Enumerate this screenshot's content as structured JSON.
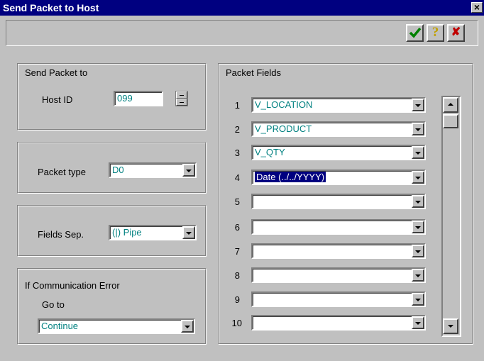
{
  "window": {
    "title": "Send Packet to Host",
    "close_glyph": "×"
  },
  "toolbar": {
    "ok_icon": "green-check-icon",
    "help_glyph": "?",
    "cancel_glyph": "✘",
    "colors": {
      "ok": "#008000",
      "help": "#c0a000",
      "cancel": "#c00000"
    }
  },
  "send_packet": {
    "group_label": "Send Packet to",
    "host_label": "Host ID",
    "host_value": "099"
  },
  "packet_type": {
    "label": "Packet type",
    "value": "D0"
  },
  "fields_sep": {
    "label": "Fields Sep.",
    "value": "(|)  Pipe"
  },
  "comm_error": {
    "group_label": "If Communication Error",
    "goto_label": "Go to",
    "value": "Continue"
  },
  "packet_fields": {
    "group_label": "Packet Fields",
    "rows": [
      {
        "num": "1",
        "value": "V_LOCATION",
        "selected": false
      },
      {
        "num": "2",
        "value": "V_PRODUCT",
        "selected": false
      },
      {
        "num": "3",
        "value": "V_QTY",
        "selected": false
      },
      {
        "num": "4",
        "value": "Date (../../YYYY)",
        "selected": true
      },
      {
        "num": "5",
        "value": "",
        "selected": false
      },
      {
        "num": "6",
        "value": "",
        "selected": false
      },
      {
        "num": "7",
        "value": "",
        "selected": false
      },
      {
        "num": "8",
        "value": "",
        "selected": false
      },
      {
        "num": "9",
        "value": "",
        "selected": false
      },
      {
        "num": "10",
        "value": "",
        "selected": false
      }
    ]
  }
}
